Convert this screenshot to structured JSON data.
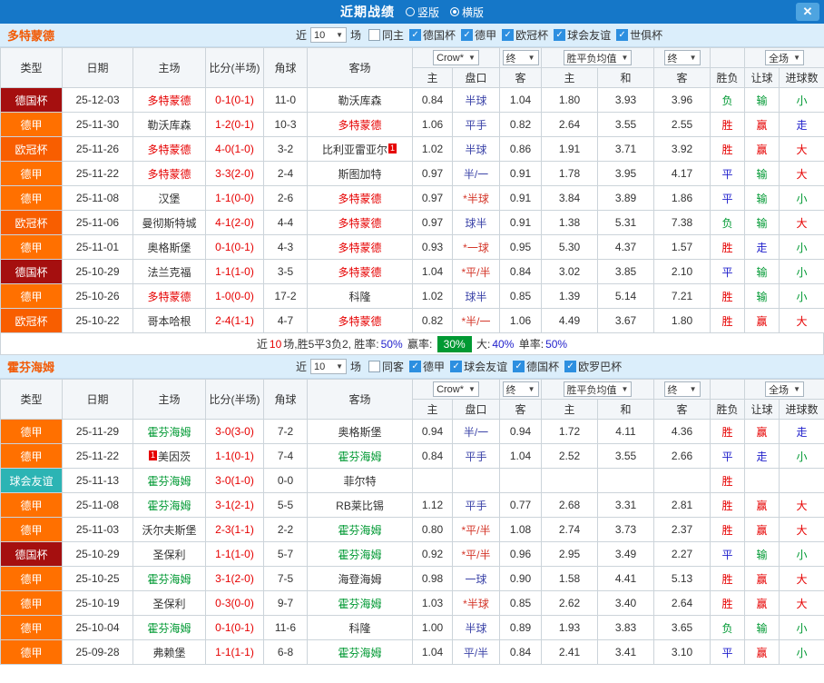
{
  "icons": {
    "dropdown": "▼",
    "close": "✕",
    "check": "✓"
  },
  "topbar": {
    "title": "近期战绩",
    "vertical": "竖版",
    "horizontal": "横版",
    "selected": "横版"
  },
  "filter": {
    "near": "近",
    "count": "10",
    "games": "场"
  },
  "table_header": {
    "type": "类型",
    "date": "日期",
    "home": "主场",
    "score": "比分(半场)",
    "corner": "角球",
    "away": "客场",
    "bookmaker": "Crow*",
    "final1": "终",
    "avg": "胜平负均值",
    "final2": "终",
    "full": "全场",
    "sub": [
      "主",
      "盘口",
      "客",
      "主",
      "和",
      "客",
      "胜负",
      "让球",
      "进球数"
    ]
  },
  "comp_colors": {
    "德国杯": "#a50f0f",
    "德甲": "#ff7000",
    "欧冠杯": "#f85e00",
    "球会友谊": "#2cb4b4"
  },
  "result_colors": {
    "r": "#e60000",
    "b": "#2222cc",
    "g": "#009933"
  },
  "sections": [
    {
      "team": "多特蒙德",
      "feat_color": "#e60000",
      "checkboxes": [
        {
          "label": "同主",
          "checked": false
        },
        {
          "label": "德国杯",
          "checked": true
        },
        {
          "label": "德甲",
          "checked": true
        },
        {
          "label": "欧冠杯",
          "checked": true
        },
        {
          "label": "球会友谊",
          "checked": true
        },
        {
          "label": "世俱杯",
          "checked": true
        }
      ],
      "rows": [
        {
          "comp": "德国杯",
          "date": "25-12-03",
          "home": "多特蒙德",
          "hf": 1,
          "score": "0-1(0-1)",
          "corner": "11-0",
          "away": "勒沃库森",
          "af": 0,
          "ah": [
            "0.84",
            "半球",
            "1.04"
          ],
          "eu": [
            "1.80",
            "3.93",
            "3.96"
          ],
          "res": [
            [
              "负",
              "g"
            ],
            [
              "输",
              "g"
            ],
            [
              "小",
              "g"
            ]
          ]
        },
        {
          "comp": "德甲",
          "date": "25-11-30",
          "home": "勒沃库森",
          "hf": 0,
          "score": "1-2(0-1)",
          "corner": "10-3",
          "away": "多特蒙德",
          "af": 1,
          "ah": [
            "1.06",
            "平手",
            "0.82"
          ],
          "eu": [
            "2.64",
            "3.55",
            "2.55"
          ],
          "res": [
            [
              "胜",
              "r"
            ],
            [
              "赢",
              "r"
            ],
            [
              "走",
              "b"
            ]
          ]
        },
        {
          "comp": "欧冠杯",
          "date": "25-11-26",
          "home": "多特蒙德",
          "hf": 1,
          "score": "4-0(1-0)",
          "corner": "3-2",
          "away": "比利亚雷亚尔",
          "af": 0,
          "ab": "1",
          "abp": "after",
          "ah": [
            "1.02",
            "半球",
            "0.86"
          ],
          "eu": [
            "1.91",
            "3.71",
            "3.92"
          ],
          "res": [
            [
              "胜",
              "r"
            ],
            [
              "赢",
              "r"
            ],
            [
              "大",
              "r"
            ]
          ]
        },
        {
          "comp": "德甲",
          "date": "25-11-22",
          "home": "多特蒙德",
          "hf": 1,
          "score": "3-3(2-0)",
          "corner": "2-4",
          "away": "斯图加特",
          "af": 0,
          "ah": [
            "0.97",
            "半/一",
            "0.91"
          ],
          "eu": [
            "1.78",
            "3.95",
            "4.17"
          ],
          "res": [
            [
              "平",
              "b"
            ],
            [
              "输",
              "g"
            ],
            [
              "大",
              "r"
            ]
          ]
        },
        {
          "comp": "德甲",
          "date": "25-11-08",
          "home": "汉堡",
          "hf": 0,
          "score": "1-1(0-0)",
          "corner": "2-6",
          "away": "多特蒙德",
          "af": 1,
          "ah": [
            "0.97",
            "*半球",
            "0.91"
          ],
          "eu": [
            "3.84",
            "3.89",
            "1.86"
          ],
          "res": [
            [
              "平",
              "b"
            ],
            [
              "输",
              "g"
            ],
            [
              "小",
              "g"
            ]
          ]
        },
        {
          "comp": "欧冠杯",
          "date": "25-11-06",
          "home": "曼彻斯特城",
          "hf": 0,
          "score": "4-1(2-0)",
          "corner": "4-4",
          "away": "多特蒙德",
          "af": 1,
          "ah": [
            "0.97",
            "球半",
            "0.91"
          ],
          "eu": [
            "1.38",
            "5.31",
            "7.38"
          ],
          "res": [
            [
              "负",
              "g"
            ],
            [
              "输",
              "g"
            ],
            [
              "大",
              "r"
            ]
          ]
        },
        {
          "comp": "德甲",
          "date": "25-11-01",
          "home": "奥格斯堡",
          "hf": 0,
          "score": "0-1(0-1)",
          "corner": "4-3",
          "away": "多特蒙德",
          "af": 1,
          "ah": [
            "0.93",
            "*一球",
            "0.95"
          ],
          "eu": [
            "5.30",
            "4.37",
            "1.57"
          ],
          "res": [
            [
              "胜",
              "r"
            ],
            [
              "走",
              "b"
            ],
            [
              "小",
              "g"
            ]
          ]
        },
        {
          "comp": "德国杯",
          "date": "25-10-29",
          "home": "法兰克福",
          "hf": 0,
          "score": "1-1(1-0)",
          "corner": "3-5",
          "away": "多特蒙德",
          "af": 1,
          "ah": [
            "1.04",
            "*平/半",
            "0.84"
          ],
          "eu": [
            "3.02",
            "3.85",
            "2.10"
          ],
          "res": [
            [
              "平",
              "b"
            ],
            [
              "输",
              "g"
            ],
            [
              "小",
              "g"
            ]
          ]
        },
        {
          "comp": "德甲",
          "date": "25-10-26",
          "home": "多特蒙德",
          "hf": 1,
          "score": "1-0(0-0)",
          "corner": "17-2",
          "away": "科隆",
          "af": 0,
          "ah": [
            "1.02",
            "球半",
            "0.85"
          ],
          "eu": [
            "1.39",
            "5.14",
            "7.21"
          ],
          "res": [
            [
              "胜",
              "r"
            ],
            [
              "输",
              "g"
            ],
            [
              "小",
              "g"
            ]
          ]
        },
        {
          "comp": "欧冠杯",
          "date": "25-10-22",
          "home": "哥本哈根",
          "hf": 0,
          "score": "2-4(1-1)",
          "corner": "4-7",
          "away": "多特蒙德",
          "af": 1,
          "ah": [
            "0.82",
            "*半/一",
            "1.06"
          ],
          "eu": [
            "4.49",
            "3.67",
            "1.80"
          ],
          "res": [
            [
              "胜",
              "r"
            ],
            [
              "赢",
              "r"
            ],
            [
              "大",
              "r"
            ]
          ]
        }
      ],
      "summary": [
        [
          "近",
          "n"
        ],
        [
          "10",
          "r"
        ],
        [
          "场,胜5平3负2, 胜率:",
          "n"
        ],
        [
          "50%",
          "b"
        ],
        [
          " 赢率: ",
          "n"
        ],
        [
          "30%",
          "badge"
        ],
        [
          " 大:",
          "n"
        ],
        [
          "40%",
          "b"
        ],
        [
          " 单率:",
          "n"
        ],
        [
          "50%",
          "b"
        ]
      ]
    },
    {
      "team": "霍芬海姆",
      "feat_color": "#009933",
      "checkboxes": [
        {
          "label": "同客",
          "checked": false
        },
        {
          "label": "德甲",
          "checked": true
        },
        {
          "label": "球会友谊",
          "checked": true
        },
        {
          "label": "德国杯",
          "checked": true
        },
        {
          "label": "欧罗巴杯",
          "checked": true
        }
      ],
      "rows": [
        {
          "comp": "德甲",
          "date": "25-11-29",
          "home": "霍芬海姆",
          "hf": 1,
          "score": "3-0(3-0)",
          "corner": "7-2",
          "away": "奥格斯堡",
          "af": 0,
          "ah": [
            "0.94",
            "半/一",
            "0.94"
          ],
          "eu": [
            "1.72",
            "4.11",
            "4.36"
          ],
          "res": [
            [
              "胜",
              "r"
            ],
            [
              "赢",
              "r"
            ],
            [
              "走",
              "b"
            ]
          ]
        },
        {
          "comp": "德甲",
          "date": "25-11-22",
          "home": "美因茨",
          "hf": 0,
          "hb": "1",
          "hbp": "before",
          "score": "1-1(0-1)",
          "corner": "7-4",
          "away": "霍芬海姆",
          "af": 1,
          "ah": [
            "0.84",
            "平手",
            "1.04"
          ],
          "eu": [
            "2.52",
            "3.55",
            "2.66"
          ],
          "res": [
            [
              "平",
              "b"
            ],
            [
              "走",
              "b"
            ],
            [
              "小",
              "g"
            ]
          ]
        },
        {
          "comp": "球会友谊",
          "date": "25-11-13",
          "home": "霍芬海姆",
          "hf": 1,
          "score": "3-0(1-0)",
          "corner": "0-0",
          "away": "菲尔特",
          "af": 0,
          "ah": [
            "",
            "",
            ""
          ],
          "eu": [
            "",
            "",
            ""
          ],
          "res": [
            [
              "胜",
              "r"
            ],
            [
              "",
              ""
            ],
            [
              "",
              ""
            ]
          ]
        },
        {
          "comp": "德甲",
          "date": "25-11-08",
          "home": "霍芬海姆",
          "hf": 1,
          "score": "3-1(2-1)",
          "corner": "5-5",
          "away": "RB莱比锡",
          "af": 0,
          "ah": [
            "1.12",
            "平手",
            "0.77"
          ],
          "eu": [
            "2.68",
            "3.31",
            "2.81"
          ],
          "res": [
            [
              "胜",
              "r"
            ],
            [
              "赢",
              "r"
            ],
            [
              "大",
              "r"
            ]
          ]
        },
        {
          "comp": "德甲",
          "date": "25-11-03",
          "home": "沃尔夫斯堡",
          "hf": 0,
          "score": "2-3(1-1)",
          "corner": "2-2",
          "away": "霍芬海姆",
          "af": 1,
          "ah": [
            "0.80",
            "*平/半",
            "1.08"
          ],
          "eu": [
            "2.74",
            "3.73",
            "2.37"
          ],
          "res": [
            [
              "胜",
              "r"
            ],
            [
              "赢",
              "r"
            ],
            [
              "大",
              "r"
            ]
          ]
        },
        {
          "comp": "德国杯",
          "date": "25-10-29",
          "home": "圣保利",
          "hf": 0,
          "score": "1-1(1-0)",
          "corner": "5-7",
          "away": "霍芬海姆",
          "af": 1,
          "ah": [
            "0.92",
            "*平/半",
            "0.96"
          ],
          "eu": [
            "2.95",
            "3.49",
            "2.27"
          ],
          "res": [
            [
              "平",
              "b"
            ],
            [
              "输",
              "g"
            ],
            [
              "小",
              "g"
            ]
          ]
        },
        {
          "comp": "德甲",
          "date": "25-10-25",
          "home": "霍芬海姆",
          "hf": 1,
          "score": "3-1(2-0)",
          "corner": "7-5",
          "away": "海登海姆",
          "af": 0,
          "ah": [
            "0.98",
            "一球",
            "0.90"
          ],
          "eu": [
            "1.58",
            "4.41",
            "5.13"
          ],
          "res": [
            [
              "胜",
              "r"
            ],
            [
              "赢",
              "r"
            ],
            [
              "大",
              "r"
            ]
          ]
        },
        {
          "comp": "德甲",
          "date": "25-10-19",
          "home": "圣保利",
          "hf": 0,
          "score": "0-3(0-0)",
          "corner": "9-7",
          "away": "霍芬海姆",
          "af": 1,
          "ah": [
            "1.03",
            "*半球",
            "0.85"
          ],
          "eu": [
            "2.62",
            "3.40",
            "2.64"
          ],
          "res": [
            [
              "胜",
              "r"
            ],
            [
              "赢",
              "r"
            ],
            [
              "大",
              "r"
            ]
          ]
        },
        {
          "comp": "德甲",
          "date": "25-10-04",
          "home": "霍芬海姆",
          "hf": 1,
          "score": "0-1(0-1)",
          "corner": "11-6",
          "away": "科隆",
          "af": 0,
          "ah": [
            "1.00",
            "半球",
            "0.89"
          ],
          "eu": [
            "1.93",
            "3.83",
            "3.65"
          ],
          "res": [
            [
              "负",
              "g"
            ],
            [
              "输",
              "g"
            ],
            [
              "小",
              "g"
            ]
          ]
        },
        {
          "comp": "德甲",
          "date": "25-09-28",
          "home": "弗赖堡",
          "hf": 0,
          "score": "1-1(1-1)",
          "corner": "6-8",
          "away": "霍芬海姆",
          "af": 1,
          "ah": [
            "1.04",
            "平/半",
            "0.84"
          ],
          "eu": [
            "2.41",
            "3.41",
            "3.10"
          ],
          "res": [
            [
              "平",
              "b"
            ],
            [
              "赢",
              "r"
            ],
            [
              "小",
              "g"
            ]
          ]
        }
      ]
    }
  ]
}
